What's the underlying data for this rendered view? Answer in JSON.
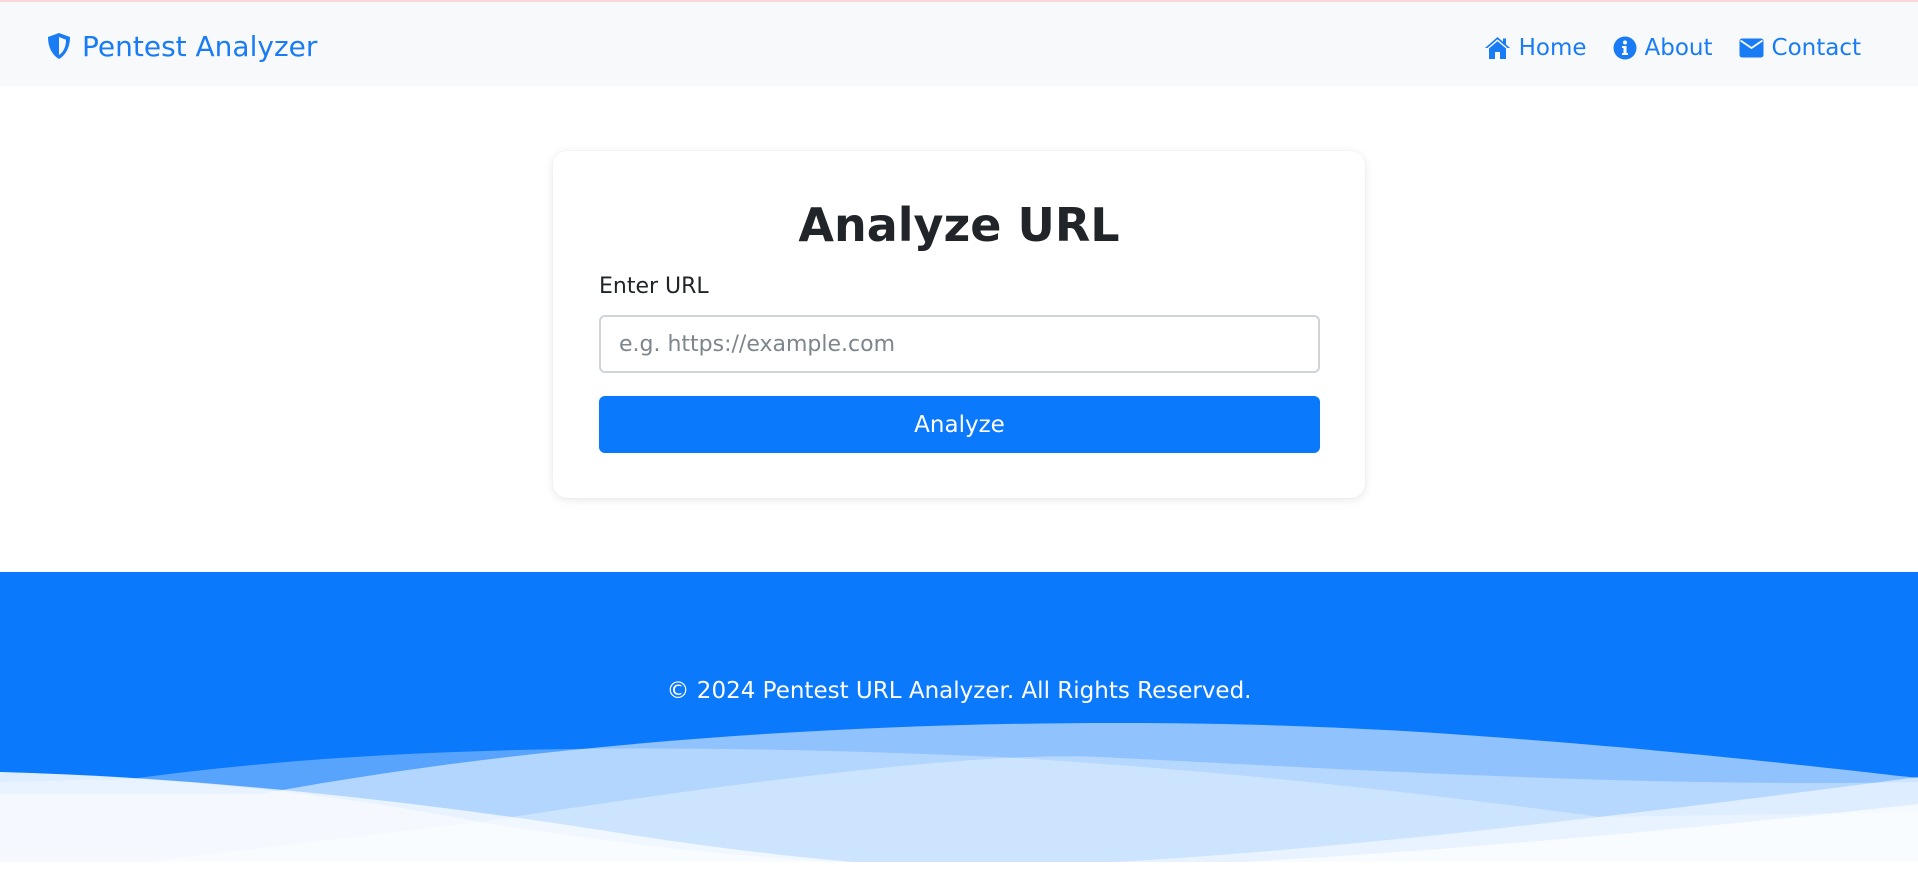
{
  "brand": {
    "icon": "shield-icon",
    "name": "Pentest Analyzer"
  },
  "nav": {
    "items": [
      {
        "label": "Home",
        "icon": "home-icon"
      },
      {
        "label": "About",
        "icon": "info-circle-icon"
      },
      {
        "label": "Contact",
        "icon": "envelope-icon"
      }
    ]
  },
  "form": {
    "title": "Analyze URL",
    "url_label": "Enter URL",
    "url_value": "",
    "url_placeholder": "e.g. https://example.com",
    "submit_label": "Analyze"
  },
  "footer": {
    "text": "© 2024 Pentest URL Analyzer. All Rights Reserved."
  },
  "colors": {
    "primary": "#0a79fb",
    "navbar_bg": "#f8f9fa",
    "text_dark": "#212529",
    "wave_light": "#a9cffc",
    "wave_lighter": "#d7e9fe"
  }
}
